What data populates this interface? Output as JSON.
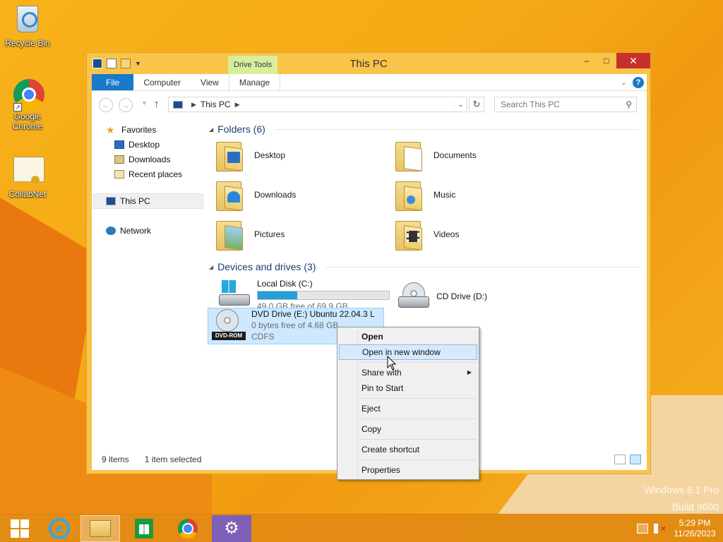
{
  "desktop": {
    "icons": [
      {
        "label": "Recycle Bin",
        "icon": "recycle-bin-icon"
      },
      {
        "label": "Google Chrome",
        "icon": "chrome-icon"
      },
      {
        "label": "CollabNet",
        "icon": "certificate-icon"
      }
    ],
    "watermark": {
      "line1": "Windows 8.1 Pro",
      "line2": "Build 9600"
    }
  },
  "window": {
    "title": "This PC",
    "contextual_tab_group": "Drive Tools",
    "ribbon_tabs": [
      "File",
      "Computer",
      "View",
      "Manage"
    ],
    "controls": {
      "minimize": "–",
      "maximize": "□",
      "close": "✕"
    }
  },
  "addressbar": {
    "path": [
      "This PC"
    ],
    "search_placeholder": "Search This PC"
  },
  "navpane": {
    "favorites": "Favorites",
    "favorite_items": [
      "Desktop",
      "Downloads",
      "Recent places"
    ],
    "this_pc": "This PC",
    "network": "Network"
  },
  "folders": {
    "header": "Folders (6)",
    "items": [
      "Desktop",
      "Documents",
      "Downloads",
      "Music",
      "Pictures",
      "Videos"
    ]
  },
  "devices": {
    "header": "Devices and drives (3)",
    "drives": [
      {
        "name": "Local Disk (C:)",
        "free": "49.0 GB free of 69.9 GB",
        "used_fraction": 0.3
      },
      {
        "name": "CD Drive (D:)"
      },
      {
        "name": "DVD Drive (E:) Ubuntu 22.04.3 L",
        "free": "0 bytes free of 4.68 GB",
        "fs": "CDFS",
        "tag": "DVD-ROM"
      }
    ]
  },
  "status": {
    "items": "9 items",
    "selected": "1 item selected"
  },
  "context_menu": {
    "items": [
      "Open",
      "Open in new window",
      "Share with",
      "Pin to Start",
      "Eject",
      "Copy",
      "Create shortcut",
      "Properties"
    ],
    "highlighted": "Open in new window"
  },
  "taskbar": {
    "clock_time": "5:29 PM",
    "clock_date": "11/26/2023"
  },
  "colors": {
    "accent": "#1979ca",
    "desktop": "#f5a815",
    "context_tab": "#d6ef9c",
    "selection": "#cde8ff"
  }
}
